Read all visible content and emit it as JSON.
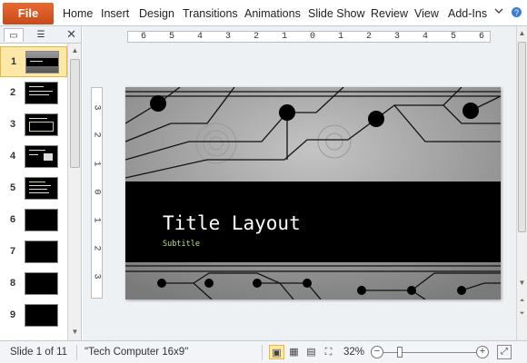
{
  "ribbon": {
    "file_label": "File",
    "tabs": [
      "Home",
      "Insert",
      "Design",
      "Transitions",
      "Animations",
      "Slide Show",
      "Review",
      "View",
      "Add-Ins"
    ],
    "accent": "#d9572a"
  },
  "left_panel": {
    "tabs": [
      "slides-tab",
      "outline-tab"
    ],
    "close_glyph": "✕",
    "slide_numbers": [
      "1",
      "2",
      "3",
      "4",
      "5",
      "6",
      "7",
      "8",
      "9"
    ],
    "selected_index": 0
  },
  "rulers": {
    "horizontal": [
      "6",
      "5",
      "4",
      "3",
      "2",
      "1",
      "0",
      "1",
      "2",
      "3",
      "4",
      "5",
      "6"
    ],
    "vertical": [
      "3",
      "2",
      "1",
      "0",
      "1",
      "2",
      "3"
    ]
  },
  "slide": {
    "title": "Title Layout",
    "subtitle": "Subtitle"
  },
  "status": {
    "slide_info": "Slide 1 of 11",
    "theme": "\"Tech Computer 16x9\"",
    "zoom": "32%",
    "zoom_level": 0.32
  }
}
